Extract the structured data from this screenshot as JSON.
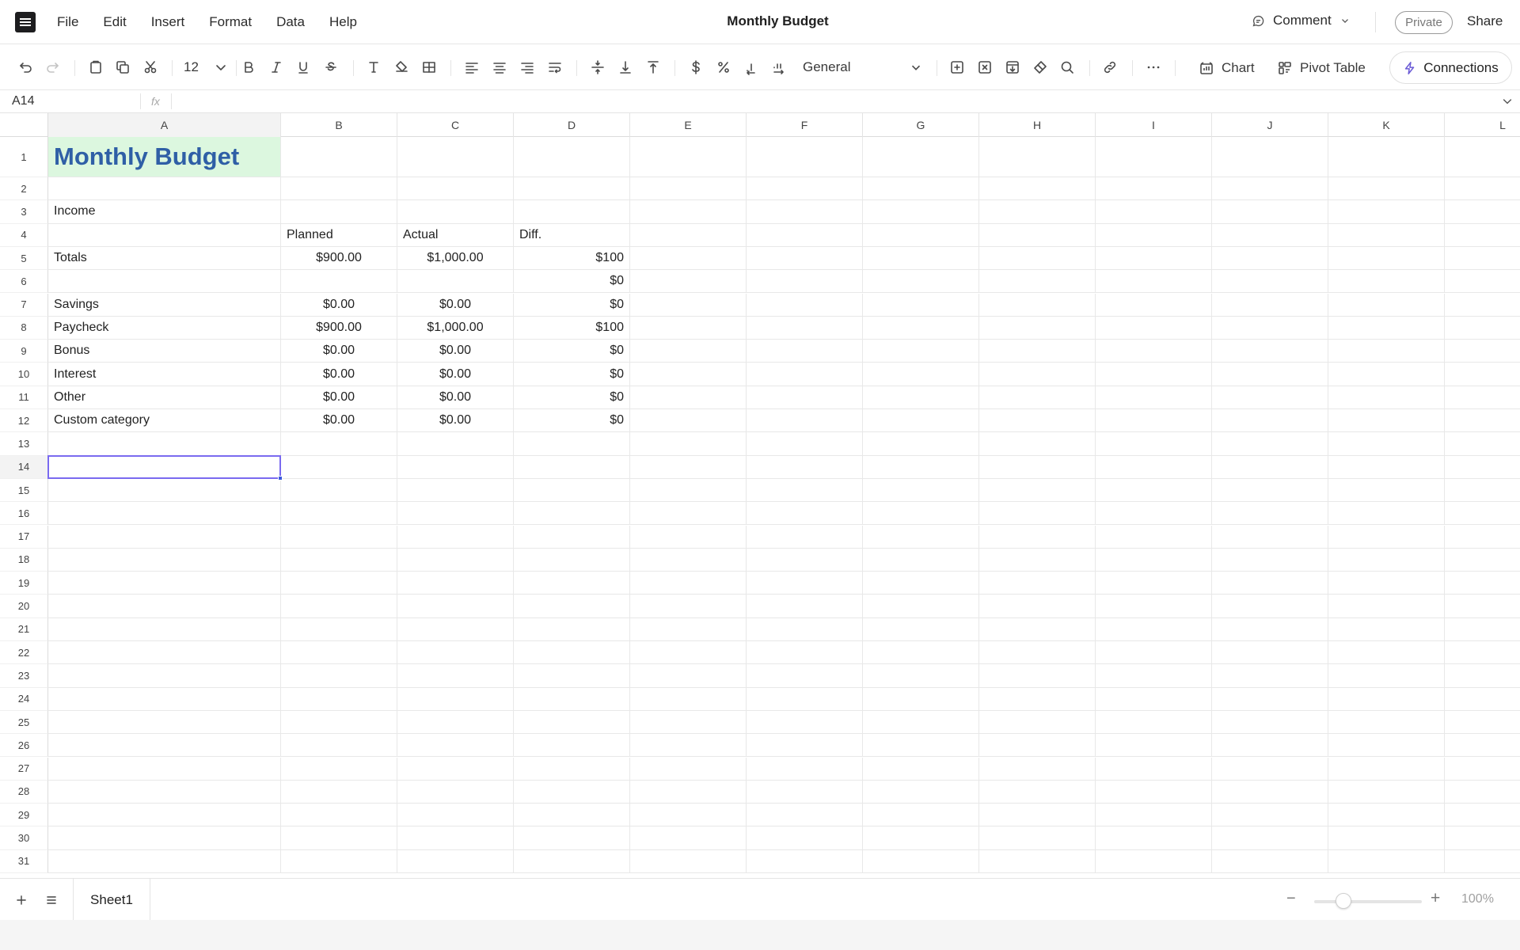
{
  "menubar": {
    "items": [
      "File",
      "Edit",
      "Insert",
      "Format",
      "Data",
      "Help"
    ],
    "doc_title": "Monthly Budget",
    "comment_label": "Comment",
    "visibility": "Private",
    "share_label": "Share"
  },
  "toolbar": {
    "font_size": "12",
    "number_format": "General",
    "chart_label": "Chart",
    "pivot_label": "Pivot Table",
    "connections_label": "Connections",
    "icons": [
      "undo-icon",
      "redo-icon",
      "paste-icon",
      "copy-icon",
      "cut-icon",
      "bold-icon",
      "italic-icon",
      "underline-icon",
      "strikethrough-icon",
      "text-color-icon",
      "fill-color-icon",
      "borders-icon",
      "align-left-icon",
      "align-center-icon",
      "align-right-icon",
      "wrap-text-icon",
      "valign-middle-icon",
      "valign-bottom-icon",
      "valign-top-icon",
      "currency-icon",
      "percent-icon",
      "decrease-decimal-icon",
      "increase-decimal-icon",
      "insert-icon",
      "delete-icon",
      "freeze-icon",
      "clear-format-icon",
      "find-icon",
      "link-icon",
      "more-icon"
    ]
  },
  "formula_bar": {
    "cell_ref": "A14",
    "fx_label": "fx",
    "value": ""
  },
  "sheet": {
    "columns": [
      "A",
      "B",
      "C",
      "D",
      "E",
      "F",
      "G",
      "H",
      "I",
      "J",
      "K",
      "L"
    ],
    "active_col": "A",
    "active_row": 14,
    "row_count": 31,
    "cells": {
      "A1": "Monthly Budget",
      "A3": "Income",
      "B4": "Planned",
      "C4": "Actual",
      "D4": "Diff.",
      "A5": "Totals",
      "B5": "$900.00",
      "C5": "$1,000.00",
      "D5": "$100",
      "D6": "$0",
      "A7": "Savings",
      "B7": "$0.00",
      "C7": "$0.00",
      "D7": "$0",
      "A8": "Paycheck",
      "B8": "$900.00",
      "C8": "$1,000.00",
      "D8": "$100",
      "A9": "Bonus",
      "B9": "$0.00",
      "C9": "$0.00",
      "D9": "$0",
      "A10": "Interest",
      "B10": "$0.00",
      "C10": "$0.00",
      "D10": "$0",
      "A11": "Other",
      "B11": "$0.00",
      "C11": "$0.00",
      "D11": "$0",
      "A12": "Custom category",
      "B12": "$0.00",
      "C12": "$0.00",
      "D12": "$0"
    }
  },
  "sheet_tabs": [
    "Sheet1"
  ],
  "zoom": {
    "level_label": "100%",
    "value": 100
  },
  "colors": {
    "title_fill": "#dcf7df",
    "title_text": "#2f5fa6",
    "selection": "#7a6af0",
    "accent": "#6b5bd6"
  }
}
